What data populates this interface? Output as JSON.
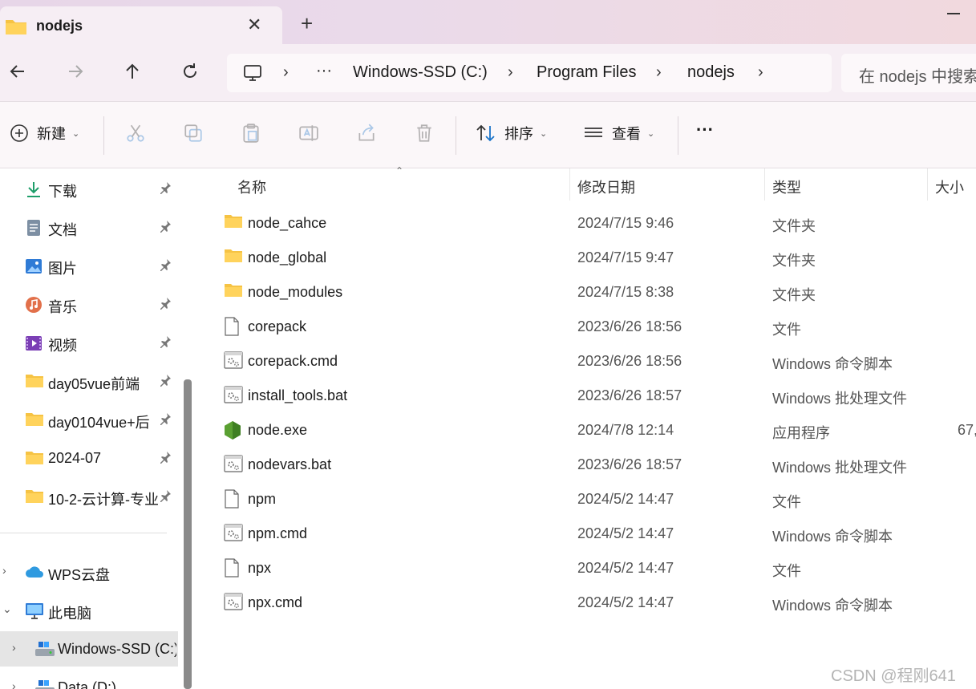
{
  "tab": {
    "title": "nodejs",
    "close": "✕",
    "new_tab": "+"
  },
  "address": {
    "ellipsis": "···",
    "crumbs": [
      "Windows-SSD (C:)",
      "Program Files",
      "nodejs"
    ],
    "sep": "›"
  },
  "search": {
    "placeholder": "在 nodejs 中搜索"
  },
  "toolbar": {
    "new_label": "新建",
    "sort_label": "排序",
    "view_label": "查看",
    "more": "···",
    "caret": "⌄"
  },
  "sidebar": {
    "pinned": [
      {
        "label": "下载",
        "icon": "download-icon"
      },
      {
        "label": "文档",
        "icon": "document-icon"
      },
      {
        "label": "图片",
        "icon": "pictures-icon"
      },
      {
        "label": "音乐",
        "icon": "music-icon"
      },
      {
        "label": "视频",
        "icon": "video-icon"
      },
      {
        "label": "day05vue前端",
        "icon": "folder-icon"
      },
      {
        "label": "day0104vue+后",
        "icon": "folder-icon"
      },
      {
        "label": "2024-07",
        "icon": "folder-icon"
      },
      {
        "label": "10-2-云计算-专业",
        "icon": "folder-icon"
      }
    ],
    "tree": [
      {
        "label": "WPS云盘",
        "chevron": "›"
      },
      {
        "label": "此电脑",
        "chevron": "⌄"
      },
      {
        "label": "Windows-SSD (C:)",
        "chevron": "›"
      },
      {
        "label": "Data (D:)",
        "chevron": "›"
      }
    ],
    "pin_glyph": "📌"
  },
  "columns": {
    "name": "名称",
    "date": "修改日期",
    "type": "类型",
    "size": "大小",
    "sort": "⌃"
  },
  "files": [
    {
      "name": "node_cahce",
      "date": "2024/7/15 9:46",
      "type": "文件夹",
      "size": "",
      "kind": "folder"
    },
    {
      "name": "node_global",
      "date": "2024/7/15 9:47",
      "type": "文件夹",
      "size": "",
      "kind": "folder"
    },
    {
      "name": "node_modules",
      "date": "2024/7/15 8:38",
      "type": "文件夹",
      "size": "",
      "kind": "folder"
    },
    {
      "name": "corepack",
      "date": "2023/6/26 18:56",
      "type": "文件",
      "size": "",
      "kind": "file"
    },
    {
      "name": "corepack.cmd",
      "date": "2023/6/26 18:56",
      "type": "Windows 命令脚本",
      "size": "",
      "kind": "script"
    },
    {
      "name": "install_tools.bat",
      "date": "2023/6/26 18:57",
      "type": "Windows 批处理文件",
      "size": "",
      "kind": "script"
    },
    {
      "name": "node.exe",
      "date": "2024/7/8 12:14",
      "type": "应用程序",
      "size": "67,",
      "kind": "exe"
    },
    {
      "name": "nodevars.bat",
      "date": "2023/6/26 18:57",
      "type": "Windows 批处理文件",
      "size": "",
      "kind": "script"
    },
    {
      "name": "npm",
      "date": "2024/5/2 14:47",
      "type": "文件",
      "size": "",
      "kind": "file"
    },
    {
      "name": "npm.cmd",
      "date": "2024/5/2 14:47",
      "type": "Windows 命令脚本",
      "size": "",
      "kind": "script"
    },
    {
      "name": "npx",
      "date": "2024/5/2 14:47",
      "type": "文件",
      "size": "",
      "kind": "file"
    },
    {
      "name": "npx.cmd",
      "date": "2024/5/2 14:47",
      "type": "Windows 命令脚本",
      "size": "",
      "kind": "script"
    }
  ],
  "watermark": "CSDN @程刚641",
  "colors": {
    "folder": "#f6c344",
    "accent": "#1a73c8",
    "node_green": "#5aa032"
  }
}
